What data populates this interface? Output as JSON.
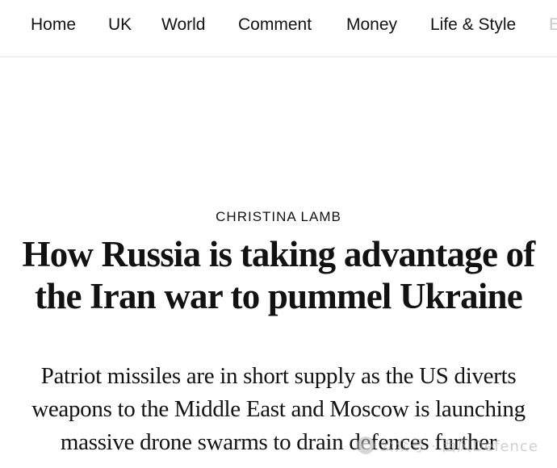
{
  "nav": {
    "items": [
      {
        "label": "Home"
      },
      {
        "label": "UK"
      },
      {
        "label": "World"
      },
      {
        "label": "Comment"
      },
      {
        "label": "Money"
      },
      {
        "label": "Life & Style"
      },
      {
        "label": "E"
      }
    ]
  },
  "article": {
    "author": "CHRISTINA LAMB",
    "headline_line1": "How Russia is taking advantage of",
    "headline_line2": "the Iran war to pummel Ukraine",
    "standfirst_line1": "Patriot missiles are in short supply as the US diverts",
    "standfirst_line2": "weapons to the Middle East and Moscow is launching",
    "standfirst_line3": "massive drone swarms to drain defences further"
  },
  "watermark": {
    "text": "公众号 · 西风Defence"
  }
}
